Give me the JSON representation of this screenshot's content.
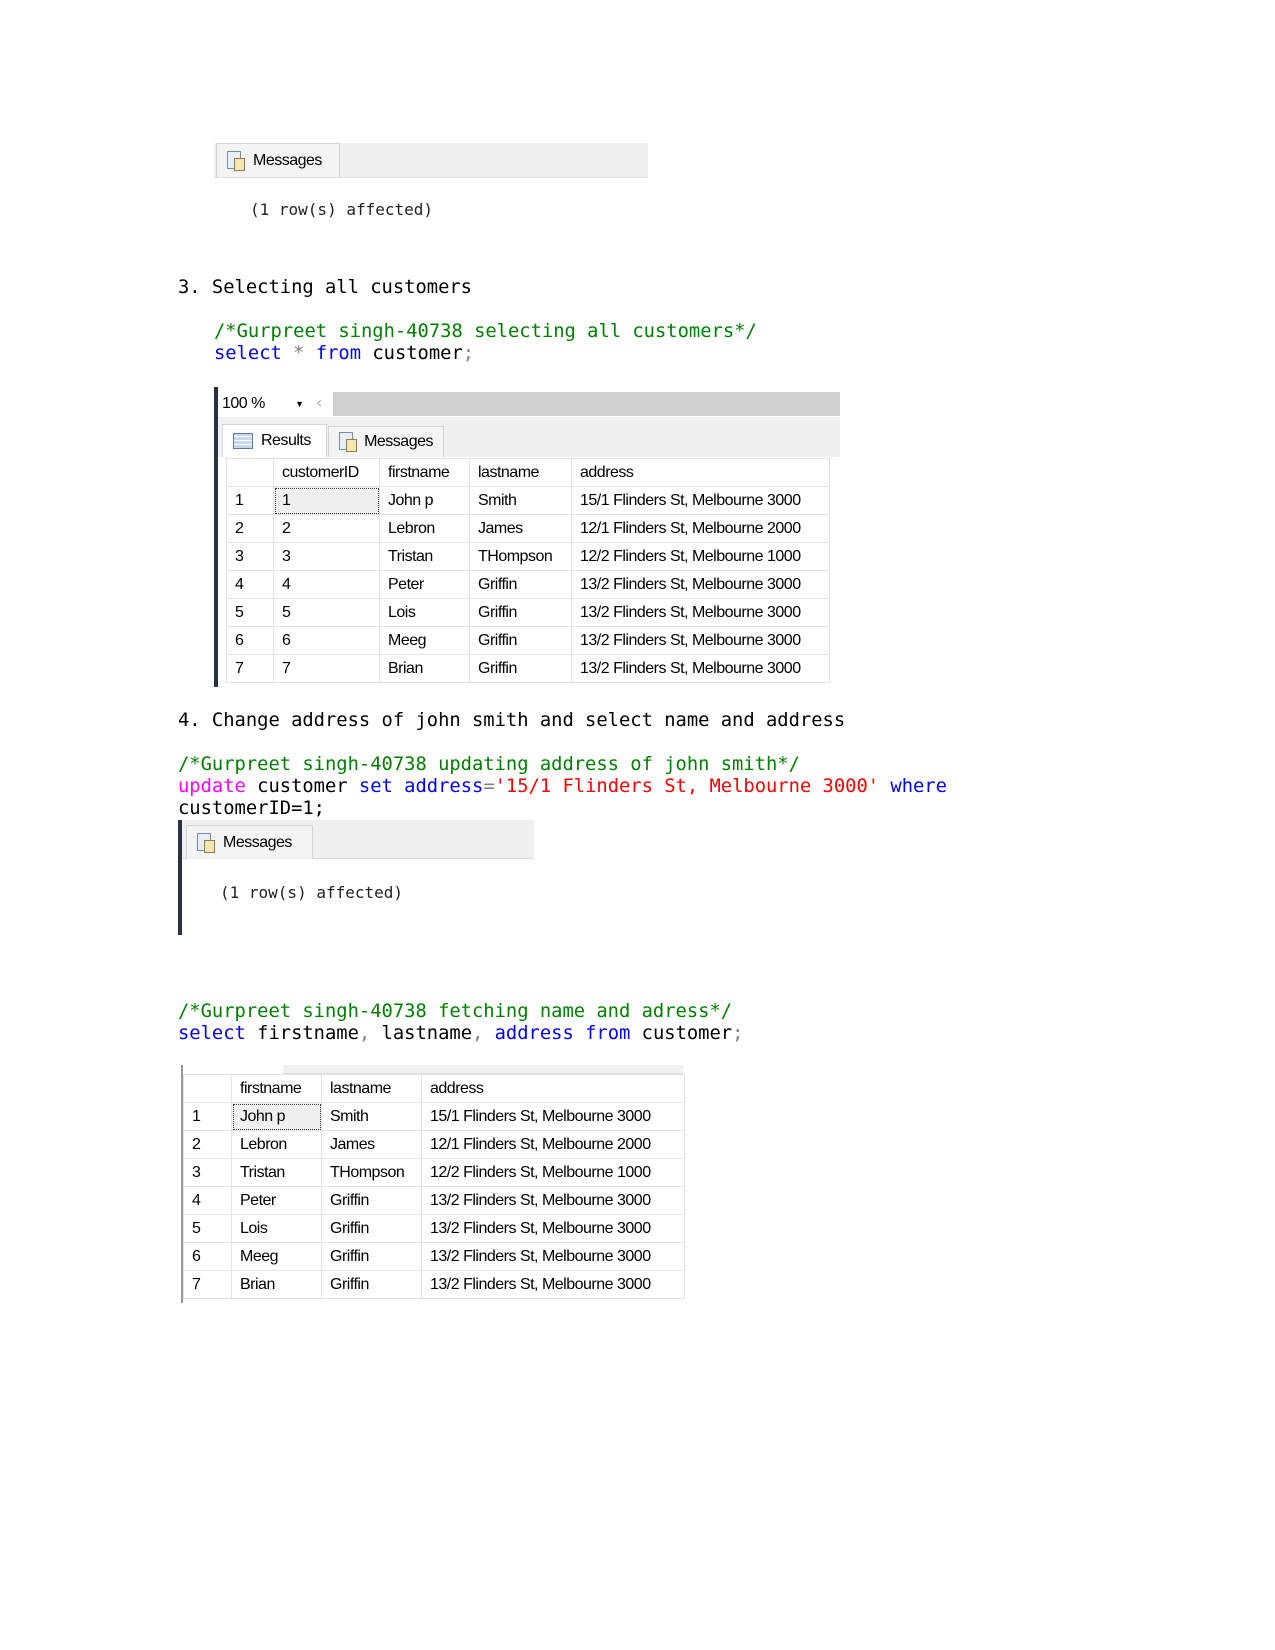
{
  "messages_tab_label": "Messages",
  "rows_affected": "(1 row(s) affected)",
  "section3": {
    "heading": "3. Selecting all customers",
    "comment": "/*Gurpreet singh-40738 selecting all customers*/",
    "sql": {
      "kw1": "select",
      "star": "*",
      "kw2": "from",
      "table": "customer",
      "end": ";"
    },
    "zoom": "100 %",
    "tabs": {
      "results": "Results",
      "messages": "Messages"
    },
    "columns": [
      "customerID",
      "firstname",
      "lastname",
      "address"
    ],
    "rows": [
      [
        "1",
        "1",
        "John p",
        "Smith",
        "15/1 Flinders St, Melbourne 3000"
      ],
      [
        "2",
        "2",
        "Lebron",
        "James",
        "12/1 Flinders St, Melbourne 2000"
      ],
      [
        "3",
        "3",
        "Tristan",
        "THompson",
        "12/2 Flinders St, Melbourne 1000"
      ],
      [
        "4",
        "4",
        "Peter",
        "Griffin",
        "13/2 Flinders St, Melbourne 3000"
      ],
      [
        "5",
        "5",
        "Lois",
        "Griffin",
        "13/2 Flinders St, Melbourne 3000"
      ],
      [
        "6",
        "6",
        "Meeg",
        "Griffin",
        "13/2 Flinders St, Melbourne 3000"
      ],
      [
        "7",
        "7",
        "Brian",
        "Griffin",
        "13/2 Flinders St, Melbourne 3000"
      ]
    ]
  },
  "section4": {
    "heading": "4. Change address of john smith and select name and address",
    "comment": "/*Gurpreet singh-40738 updating address of john smith*/",
    "update": {
      "kw1": "update",
      "t1": " customer ",
      "kw2": "set",
      "sp": " ",
      "kw3": "address",
      "eq": "=",
      "val": "'15/1 Flinders St, Melbourne 3000'",
      "sp2": " ",
      "kw4": "where",
      "line2": "customerID=1;"
    },
    "comment2": "/*Gurpreet singh-40738 fetching name and adress*/",
    "select": {
      "kw1": "select",
      "t1": " firstname",
      "c1": ",",
      "t2": " lastname",
      "c2": ",",
      "sp": " ",
      "kw2": "address",
      "sp2": " ",
      "kw3": "from",
      "t3": " customer",
      "end": ";"
    },
    "columns": [
      "firstname",
      "lastname",
      "address"
    ],
    "rows": [
      [
        "1",
        "John p",
        "Smith",
        "15/1 Flinders St, Melbourne 3000"
      ],
      [
        "2",
        "Lebron",
        "James",
        "12/1 Flinders St, Melbourne 2000"
      ],
      [
        "3",
        "Tristan",
        "THompson",
        "12/2 Flinders St, Melbourne 1000"
      ],
      [
        "4",
        "Peter",
        "Griffin",
        "13/2 Flinders St, Melbourne 3000"
      ],
      [
        "5",
        "Lois",
        "Griffin",
        "13/2 Flinders St, Melbourne 3000"
      ],
      [
        "6",
        "Meeg",
        "Griffin",
        "13/2 Flinders St, Melbourne 3000"
      ],
      [
        "7",
        "Brian",
        "Griffin",
        "13/2 Flinders St, Melbourne 3000"
      ]
    ]
  }
}
